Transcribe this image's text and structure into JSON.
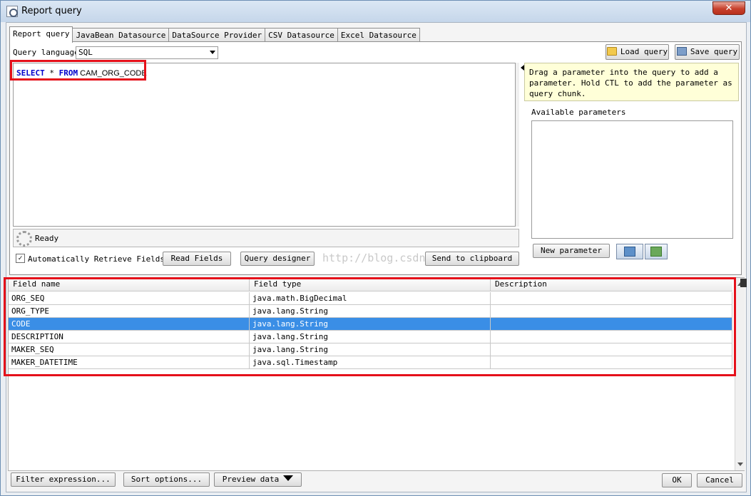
{
  "window": {
    "title": "Report query",
    "close_label": "✕"
  },
  "tabs": [
    {
      "label": "Report query",
      "active": true
    },
    {
      "label": "JavaBean Datasource",
      "active": false
    },
    {
      "label": "DataSource Provider",
      "active": false
    },
    {
      "label": "CSV Datasource",
      "active": false
    },
    {
      "label": "Excel Datasource",
      "active": false
    }
  ],
  "query": {
    "language_label": "Query language",
    "language_value": "SQL",
    "load_label": "Load query",
    "save_label": "Save query",
    "sql_kw1": "SELECT",
    "sql_star": " * ",
    "sql_kw2": "FROM",
    "sql_table": " CAM_ORG_CODE",
    "status": "Ready",
    "auto_retrieve_label": "Automatically Retrieve Fields",
    "auto_retrieve_checked": "✓",
    "read_fields_label": "Read Fields",
    "designer_label": "Query designer",
    "clipboard_label": "Send to clipboard",
    "watermark": "http://blog.csdn.ne"
  },
  "parameters": {
    "hint": "Drag a parameter into the query to add a parameter. Hold CTL to add the parameter as query chunk.",
    "available_label": "Available parameters",
    "new_label": "New parameter",
    "icons": [
      "arrow-right-icon",
      "arrow-down-icon"
    ]
  },
  "fields": {
    "columns": [
      "Field name",
      "Field type",
      "Description"
    ],
    "rows": [
      {
        "name": "ORG_SEQ",
        "type": "java.math.BigDecimal",
        "desc": "",
        "selected": false
      },
      {
        "name": "ORG_TYPE",
        "type": "java.lang.String",
        "desc": "",
        "selected": false
      },
      {
        "name": "CODE",
        "type": "java.lang.String",
        "desc": "",
        "selected": true
      },
      {
        "name": "DESCRIPTION",
        "type": "java.lang.String",
        "desc": "",
        "selected": false
      },
      {
        "name": "MAKER_SEQ",
        "type": "java.lang.String",
        "desc": "",
        "selected": false
      },
      {
        "name": "MAKER_DATETIME",
        "type": "java.sql.Timestamp",
        "desc": "",
        "selected": false
      }
    ]
  },
  "footer": {
    "filter_label": "Filter expression...",
    "sort_label": "Sort options...",
    "preview_label": "Preview data",
    "ok_label": "OK",
    "cancel_label": "Cancel"
  },
  "colors": {
    "highlight": "#e5101a",
    "selection": "#3a8ee6",
    "keyword": "#0000cc"
  }
}
